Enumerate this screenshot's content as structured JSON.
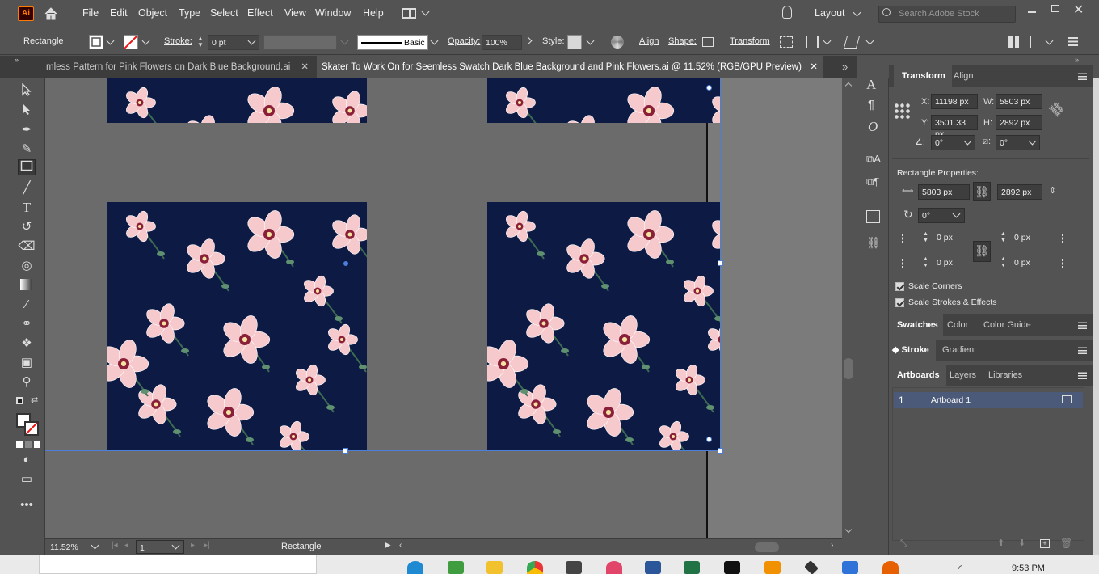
{
  "menubar": {
    "app_badge": "Ai",
    "items": [
      "File",
      "Edit",
      "Object",
      "Type",
      "Select",
      "Effect",
      "View",
      "Window",
      "Help"
    ],
    "workspace": "Layout",
    "search_placeholder": "Search Adobe Stock"
  },
  "options": {
    "selection_type": "Rectangle",
    "stroke_label": "Stroke:",
    "stroke_value": "0 pt",
    "brush_label": "Basic",
    "opacity_label": "Opacity:",
    "opacity_value": "100%",
    "style_label": "Style:",
    "align_label": "Align",
    "shape_label": "Shape:",
    "transform_label": "Transform"
  },
  "tabs": [
    {
      "label": "mless Pattern for Pink Flowers on Dark Blue Background.ai",
      "active": false
    },
    {
      "label": "Skater To Work On for Seemless Swatch Dark Blue Background and Pink Flowers.ai @ 11.52% (RGB/GPU Preview)",
      "active": true
    }
  ],
  "status": {
    "zoom": "11.52%",
    "artboard_number": "1",
    "tool_name": "Rectangle"
  },
  "transform_panel": {
    "tab_transform": "Transform",
    "tab_align": "Align",
    "x_label": "X:",
    "x_value": "11198 px",
    "y_label": "Y:",
    "y_value": "3501.33 px",
    "w_label": "W:",
    "w_value": "5803 px",
    "h_label": "H:",
    "h_value": "2892 px",
    "rotate_value": "0°",
    "shear_value": "0°",
    "rect_props_label": "Rectangle Properties:",
    "rect_w": "5803 px",
    "rect_h": "2892 px",
    "rect_rotate": "0°",
    "corner_tl": "0 px",
    "corner_tr": "0 px",
    "corner_bl": "0 px",
    "corner_br": "0 px",
    "scale_corners": "Scale Corners",
    "scale_strokes": "Scale Strokes & Effects"
  },
  "swatches_panel": {
    "tabs": [
      "Swatches",
      "Color",
      "Color Guide"
    ]
  },
  "stroke_panel": {
    "tabs": [
      "Stroke",
      "Gradient"
    ]
  },
  "artboards_panel": {
    "tabs": [
      "Artboards",
      "Layers",
      "Libraries"
    ],
    "rows": [
      {
        "number": "1",
        "name": "Artboard 1"
      }
    ]
  },
  "taskbar": {
    "time": "9:53 PM"
  },
  "colors": {
    "ui_bg": "#535353",
    "canvas_bg": "#6b6b6b",
    "artwork_bg": "#0d1a44",
    "petal": "#f6c9cd",
    "selection": "#4c7fd9",
    "app_badge": "#ff7c00"
  }
}
